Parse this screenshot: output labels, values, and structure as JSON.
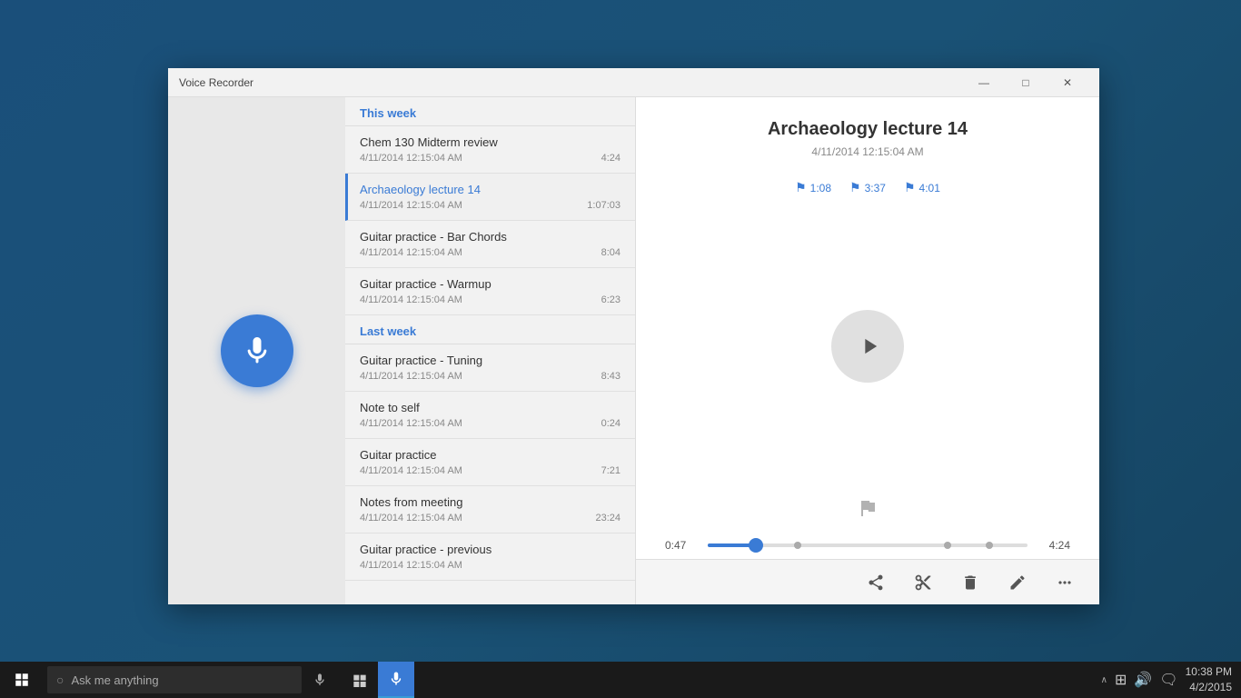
{
  "app": {
    "title": "Voice Recorder",
    "window_controls": {
      "minimize": "—",
      "maximize": "□",
      "close": "✕"
    }
  },
  "sections": {
    "this_week": {
      "label": "This week",
      "items": [
        {
          "name": "Chem 130 Midterm review",
          "date": "4/11/2014 12:15:04 AM",
          "duration": "4:24",
          "active": false
        },
        {
          "name": "Archaeology lecture 14",
          "date": "4/11/2014 12:15:04 AM",
          "duration": "1:07:03",
          "active": true
        },
        {
          "name": "Guitar practice - Bar Chords",
          "date": "4/11/2014 12:15:04 AM",
          "duration": "8:04",
          "active": false
        },
        {
          "name": "Guitar practice - Warmup",
          "date": "4/11/2014 12:15:04 AM",
          "duration": "6:23",
          "active": false
        }
      ]
    },
    "last_week": {
      "label": "Last week",
      "items": [
        {
          "name": "Guitar practice - Tuning",
          "date": "4/11/2014 12:15:04 AM",
          "duration": "8:43",
          "active": false
        },
        {
          "name": "Note to self",
          "date": "4/11/2014 12:15:04 AM",
          "duration": "0:24",
          "active": false
        },
        {
          "name": "Guitar practice",
          "date": "4/11/2014 12:15:04 AM",
          "duration": "7:21",
          "active": false
        },
        {
          "name": "Notes from meeting",
          "date": "4/11/2014 12:15:04 AM",
          "duration": "23:24",
          "active": false
        },
        {
          "name": "Guitar practice - previous",
          "date": "4/11/2014 12:15:04 AM",
          "duration": "",
          "active": false
        }
      ]
    }
  },
  "detail": {
    "title": "Archaeology lecture 14",
    "date": "4/11/2014 12:15:04 AM",
    "markers": [
      {
        "time": "1:08"
      },
      {
        "time": "3:37"
      },
      {
        "time": "4:01"
      }
    ],
    "current_time": "0:47",
    "total_time": "4:24",
    "progress_percent": 15
  },
  "toolbar": {
    "share_label": "Share",
    "trim_label": "Trim",
    "delete_label": "Delete",
    "rename_label": "Rename",
    "more_label": "More"
  },
  "taskbar": {
    "search_placeholder": "Ask me anything",
    "time": "10:38 PM",
    "date": "4/2/2015"
  }
}
